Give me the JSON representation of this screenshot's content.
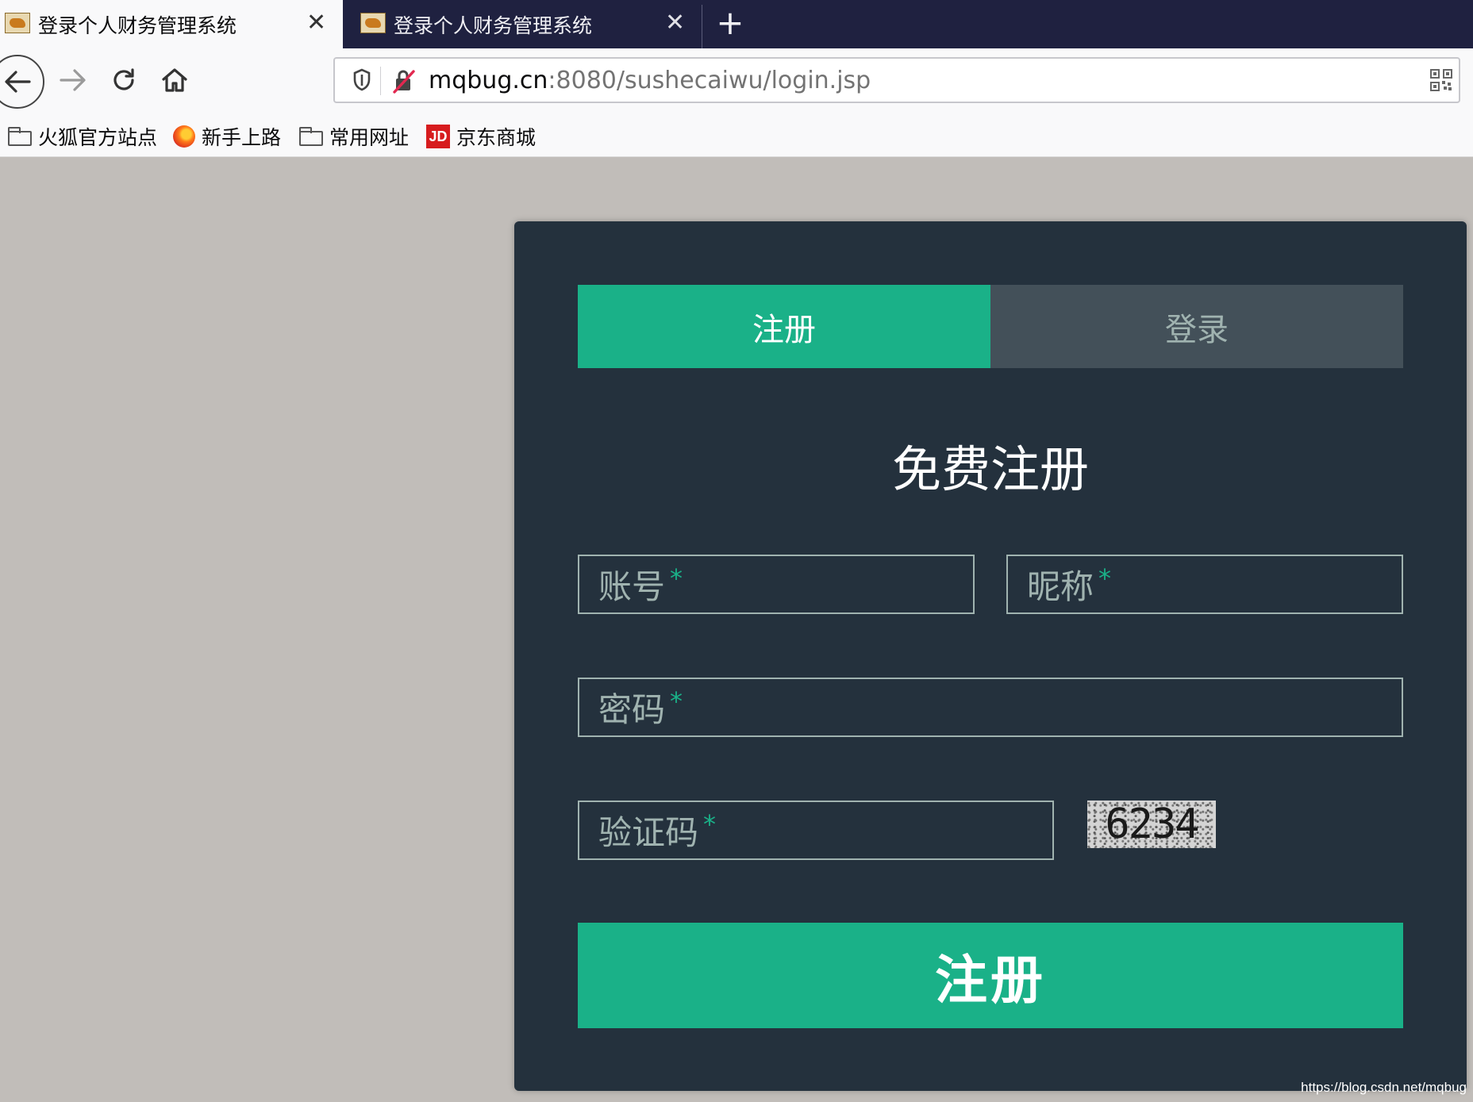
{
  "browser": {
    "tabs": [
      {
        "title": "登录个人财务管理系统",
        "active": true
      },
      {
        "title": "登录个人财务管理系统",
        "active": false
      }
    ],
    "close_glyph": "✕",
    "new_tab_glyph": "+",
    "url": {
      "host": "mqbug.cn",
      "rest": ":8080/sushecaiwu/login.jsp"
    },
    "bookmarks": [
      {
        "label": "火狐官方站点",
        "icon": "folder-icon"
      },
      {
        "label": "新手上路",
        "icon": "firefox-icon"
      },
      {
        "label": "常用网址",
        "icon": "folder-icon"
      },
      {
        "label": "京东商城",
        "icon": "jd-icon"
      }
    ],
    "jd_badge": "JD"
  },
  "form": {
    "tabs": {
      "register": "注册",
      "login": "登录"
    },
    "heading": "免费注册",
    "fields": {
      "account": "账号",
      "nickname": "昵称",
      "password": "密码",
      "captcha": "验证码"
    },
    "required_mark": "*",
    "captcha_image_text": "6234",
    "submit_label": "注册"
  },
  "watermark": "https://blog.csdn.net/mqbug",
  "colors": {
    "accent": "#1ab188",
    "panel": "#24313d",
    "inactive_tab": "#435059",
    "page_background": "#c1bdb9"
  }
}
